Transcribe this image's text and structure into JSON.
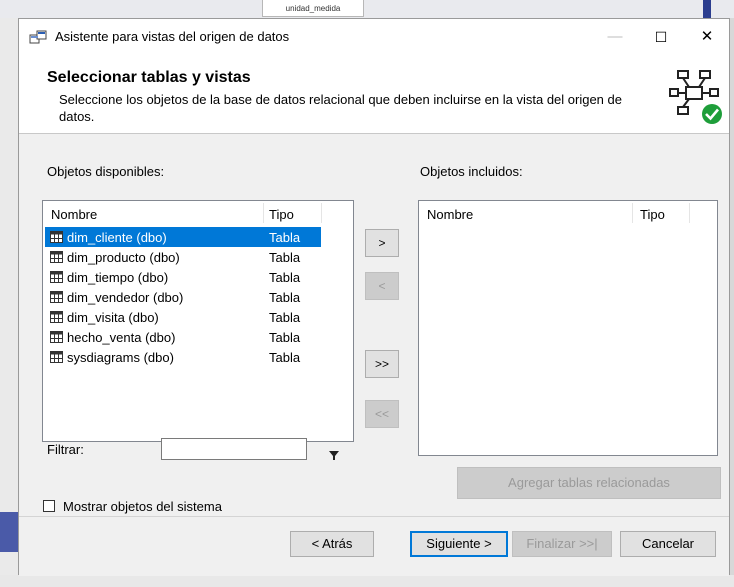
{
  "background": {
    "tab_label": "unidad_medida"
  },
  "window": {
    "title": "Asistente para vistas del origen de datos",
    "minimize": "—",
    "maximize": "☐",
    "close": "✕"
  },
  "header": {
    "title": "Seleccionar tablas y vistas",
    "description": "Seleccione los objetos de la base de datos relacional que deben incluirse en la vista del origen de datos."
  },
  "available": {
    "label": "Objetos disponibles:",
    "col_name": "Nombre",
    "col_type": "Tipo",
    "rows": [
      {
        "name": "dim_cliente (dbo)",
        "type": "Tabla"
      },
      {
        "name": "dim_producto (dbo)",
        "type": "Tabla"
      },
      {
        "name": "dim_tiempo (dbo)",
        "type": "Tabla"
      },
      {
        "name": "dim_vendedor (dbo)",
        "type": "Tabla"
      },
      {
        "name": "dim_visita (dbo)",
        "type": "Tabla"
      },
      {
        "name": "hecho_venta (dbo)",
        "type": "Tabla"
      },
      {
        "name": "sysdiagrams (dbo)",
        "type": "Tabla"
      }
    ],
    "selected_index": 0
  },
  "included": {
    "label": "Objetos incluidos:",
    "col_name": "Nombre",
    "col_type": "Tipo"
  },
  "transfer": {
    "add_one": ">",
    "remove_one": "<",
    "add_all": ">>",
    "remove_all": "<<"
  },
  "filter": {
    "label": "Filtrar:",
    "value": ""
  },
  "related_button": "Agregar tablas relacionadas",
  "show_system": {
    "label": "Mostrar objetos del sistema",
    "checked": false
  },
  "footer": {
    "back": "< Atrás",
    "next": "Siguiente >",
    "finish": "Finalizar >>|",
    "cancel": "Cancelar"
  },
  "colors": {
    "selection": "#0078d7",
    "dialog_bg": "#f0f0f0",
    "disabled_button": "#cccccc"
  }
}
